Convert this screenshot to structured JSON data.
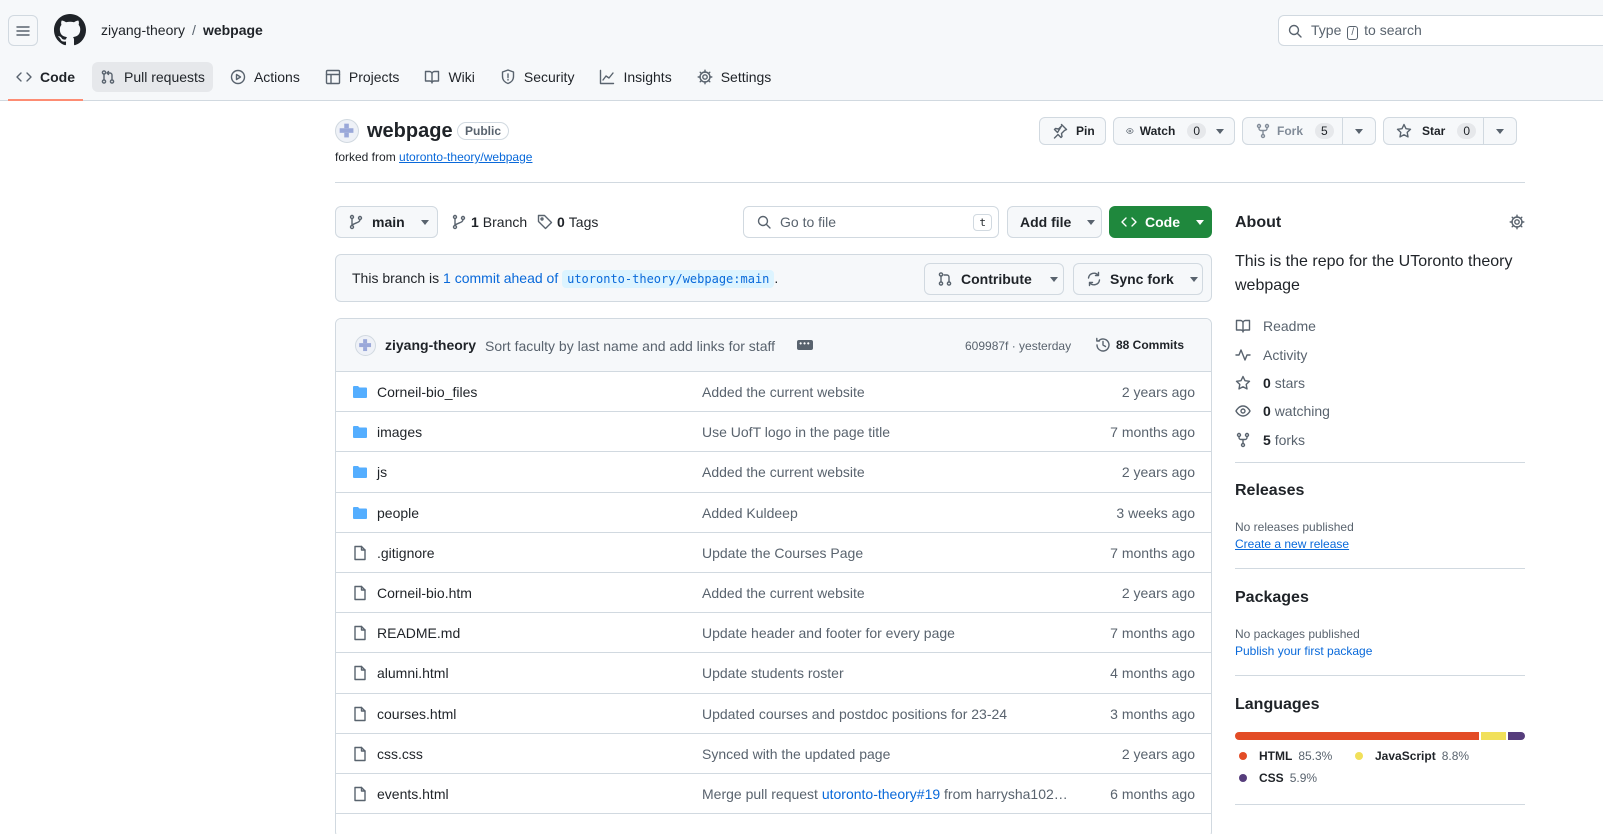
{
  "header": {
    "owner": "ziyang-theory",
    "separator": "/",
    "repo": "webpage",
    "search_pre": "Type",
    "search_slash": "/",
    "search_post": "to search"
  },
  "tabs": [
    {
      "label": "Code",
      "icon": "code-icon"
    },
    {
      "label": "Pull requests",
      "icon": "pull-request-icon"
    },
    {
      "label": "Actions",
      "icon": "play-icon"
    },
    {
      "label": "Projects",
      "icon": "table-icon"
    },
    {
      "label": "Wiki",
      "icon": "book-icon"
    },
    {
      "label": "Security",
      "icon": "shield-icon"
    },
    {
      "label": "Insights",
      "icon": "graph-icon"
    },
    {
      "label": "Settings",
      "icon": "gear-icon"
    }
  ],
  "repo": {
    "name": "webpage",
    "visibility": "Public",
    "forked_prefix": "forked from",
    "forked_from": "utoronto-theory/webpage",
    "pin_label": "Pin",
    "watch_label": "Watch",
    "watch_count": "0",
    "fork_label": "Fork",
    "fork_count": "5",
    "star_label": "Star",
    "star_count": "0"
  },
  "branch": {
    "current": "main",
    "branches_count": "1",
    "branches_label": "Branch",
    "tags_count": "0",
    "tags_label": "Tags",
    "goto_placeholder": "Go to file",
    "goto_key": "t",
    "add_file_label": "Add file",
    "code_label": "Code"
  },
  "ahead": {
    "prefix": "This branch is",
    "link": "1 commit ahead of",
    "ref": "utoronto-theory/webpage:main",
    "suffix": ".",
    "contribute_label": "Contribute",
    "sync_label": "Sync fork"
  },
  "latest_commit": {
    "author": "ziyang-theory",
    "message": "Sort faculty by last name and add links for staff",
    "sha_time": "609987f · yesterday",
    "commits_label": "88 Commits"
  },
  "files": [
    {
      "type": "dir",
      "name": "Corneil-bio_files",
      "message": "Added the current website",
      "age": "2 years ago"
    },
    {
      "type": "dir",
      "name": "images",
      "message": "Use UofT logo in the page title",
      "age": "7 months ago"
    },
    {
      "type": "dir",
      "name": "js",
      "message": "Added the current website",
      "age": "2 years ago"
    },
    {
      "type": "dir",
      "name": "people",
      "message": "Added Kuldeep",
      "age": "3 weeks ago"
    },
    {
      "type": "file",
      "name": ".gitignore",
      "message": "Update the Courses Page",
      "age": "7 months ago"
    },
    {
      "type": "file",
      "name": "Corneil-bio.htm",
      "message": "Added the current website",
      "age": "2 years ago"
    },
    {
      "type": "file",
      "name": "README.md",
      "message": "Update header and footer for every page",
      "age": "7 months ago"
    },
    {
      "type": "file",
      "name": "alumni.html",
      "message": "Update students roster",
      "age": "4 months ago"
    },
    {
      "type": "file",
      "name": "courses.html",
      "message": "Updated courses and postdoc positions for 23-24",
      "age": "3 months ago"
    },
    {
      "type": "file",
      "name": "css.css",
      "message": "Synced with the updated page",
      "age": "2 years ago"
    },
    {
      "type": "file",
      "name": "events.html",
      "message_pre": "Merge pull request",
      "message_link": "utoronto-theory#19",
      "message_post": "from harrysha102…",
      "age": "6 months ago"
    }
  ],
  "about": {
    "title": "About",
    "description": "This is the repo for the UToronto theory webpage",
    "readme": "Readme",
    "activity": "Activity",
    "stars_count": "0",
    "stars_label": "stars",
    "watching_count": "0",
    "watching_label": "watching",
    "forks_count": "5",
    "forks_label": "forks"
  },
  "releases": {
    "title": "Releases",
    "empty": "No releases published",
    "link": "Create a new release"
  },
  "packages": {
    "title": "Packages",
    "empty": "No packages published",
    "link": "Publish your first package"
  },
  "languages": {
    "title": "Languages",
    "items": [
      {
        "name": "HTML",
        "pct": "85.3%",
        "value": 85.3,
        "color": "#e34c26"
      },
      {
        "name": "JavaScript",
        "pct": "8.8%",
        "value": 8.8,
        "color": "#f1e05a"
      },
      {
        "name": "CSS",
        "pct": "5.9%",
        "value": 5.9,
        "color": "#563d7c"
      }
    ]
  },
  "colors": {
    "accent": "#0969da",
    "primary_button": "#1f883d",
    "active_tab_underline": "#fd8c73",
    "folder": "#54aeff"
  }
}
